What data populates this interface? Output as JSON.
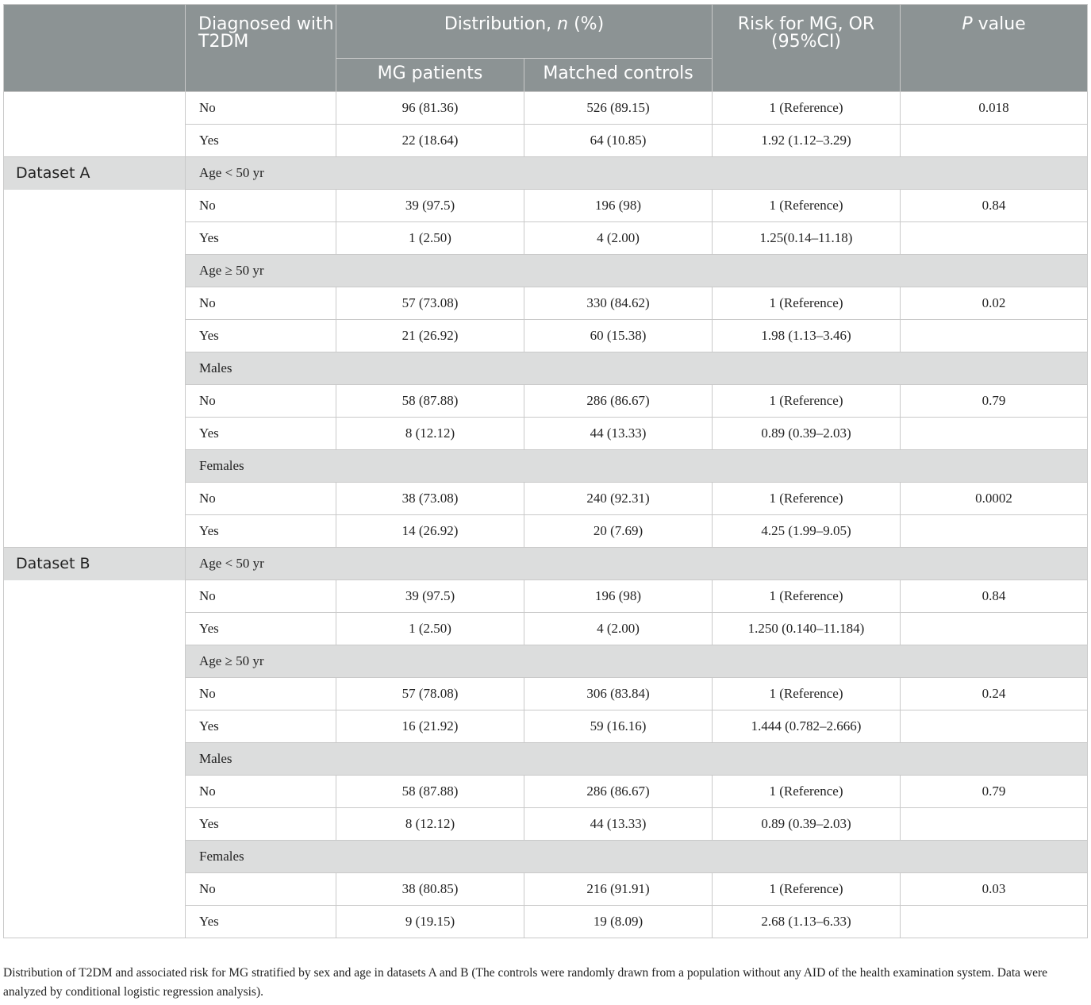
{
  "header": {
    "col_diag": "Diagnosed with T2DM",
    "col_dist_prefix": "Distribution, ",
    "col_dist_n": "n",
    "col_dist_suffix": " (%)",
    "col_risk": "Risk for MG, OR (95%CI)",
    "col_p_italic": "P",
    "col_p_rest": " value",
    "sub_mg": "MG patients",
    "sub_ctrl": "Matched controls"
  },
  "overall": [
    {
      "label": "No",
      "mg": "96 (81.36)",
      "ctrl": "526 (89.15)",
      "or": "1 (Reference)",
      "p": "0.018"
    },
    {
      "label": "Yes",
      "mg": "22 (18.64)",
      "ctrl": "64 (10.85)",
      "or": "1.92 (1.12–3.29)",
      "p": ""
    }
  ],
  "datasetA": {
    "name": "Dataset A",
    "groups": [
      {
        "title": "Age < 50 yr",
        "rows": [
          {
            "label": "No",
            "mg": "39 (97.5)",
            "ctrl": "196 (98)",
            "or": "1 (Reference)",
            "p": "0.84"
          },
          {
            "label": "Yes",
            "mg": "1 (2.50)",
            "ctrl": "4 (2.00)",
            "or": "1.25(0.14–11.18)",
            "p": ""
          }
        ]
      },
      {
        "title": "Age ≥ 50 yr",
        "rows": [
          {
            "label": "No",
            "mg": "57 (73.08)",
            "ctrl": "330 (84.62)",
            "or": "1 (Reference)",
            "p": "0.02"
          },
          {
            "label": "Yes",
            "mg": "21 (26.92)",
            "ctrl": "60 (15.38)",
            "or": "1.98 (1.13–3.46)",
            "p": ""
          }
        ]
      },
      {
        "title": "Males",
        "rows": [
          {
            "label": "No",
            "mg": "58 (87.88)",
            "ctrl": "286 (86.67)",
            "or": "1 (Reference)",
            "p": "0.79"
          },
          {
            "label": "Yes",
            "mg": "8 (12.12)",
            "ctrl": "44 (13.33)",
            "or": "0.89 (0.39–2.03)",
            "p": ""
          }
        ]
      },
      {
        "title": "Females",
        "rows": [
          {
            "label": "No",
            "mg": "38 (73.08)",
            "ctrl": "240 (92.31)",
            "or": "1 (Reference)",
            "p": "0.0002"
          },
          {
            "label": "Yes",
            "mg": "14 (26.92)",
            "ctrl": "20 (7.69)",
            "or": "4.25 (1.99–9.05)",
            "p": ""
          }
        ]
      }
    ]
  },
  "datasetB": {
    "name": "Dataset B",
    "groups": [
      {
        "title": "Age < 50 yr",
        "rows": [
          {
            "label": "No",
            "mg": "39 (97.5)",
            "ctrl": "196 (98)",
            "or": "1 (Reference)",
            "p": "0.84"
          },
          {
            "label": "Yes",
            "mg": "1 (2.50)",
            "ctrl": "4 (2.00)",
            "or": "1.250 (0.140–11.184)",
            "p": ""
          }
        ]
      },
      {
        "title": "Age ≥ 50 yr",
        "rows": [
          {
            "label": "No",
            "mg": "57 (78.08)",
            "ctrl": "306 (83.84)",
            "or": "1 (Reference)",
            "p": "0.24"
          },
          {
            "label": "Yes",
            "mg": "16 (21.92)",
            "ctrl": "59 (16.16)",
            "or": "1.444 (0.782–2.666)",
            "p": ""
          }
        ]
      },
      {
        "title": "Males",
        "rows": [
          {
            "label": "No",
            "mg": "58 (87.88)",
            "ctrl": "286 (86.67)",
            "or": "1 (Reference)",
            "p": "0.79"
          },
          {
            "label": "Yes",
            "mg": "8 (12.12)",
            "ctrl": "44 (13.33)",
            "or": "0.89 (0.39–2.03)",
            "p": ""
          }
        ]
      },
      {
        "title": "Females",
        "rows": [
          {
            "label": "No",
            "mg": "38 (80.85)",
            "ctrl": "216 (91.91)",
            "or": "1 (Reference)",
            "p": "0.03"
          },
          {
            "label": "Yes",
            "mg": "9 (19.15)",
            "ctrl": "19 (8.09)",
            "or": "2.68 (1.13–6.33)",
            "p": ""
          }
        ]
      }
    ]
  },
  "footnote": "Distribution of T2DM and associated risk for MG stratified by sex and age in datasets A and B (The controls were randomly drawn from a population without any AID of the health examination system. Data were analyzed by conditional logistic regression analysis)."
}
